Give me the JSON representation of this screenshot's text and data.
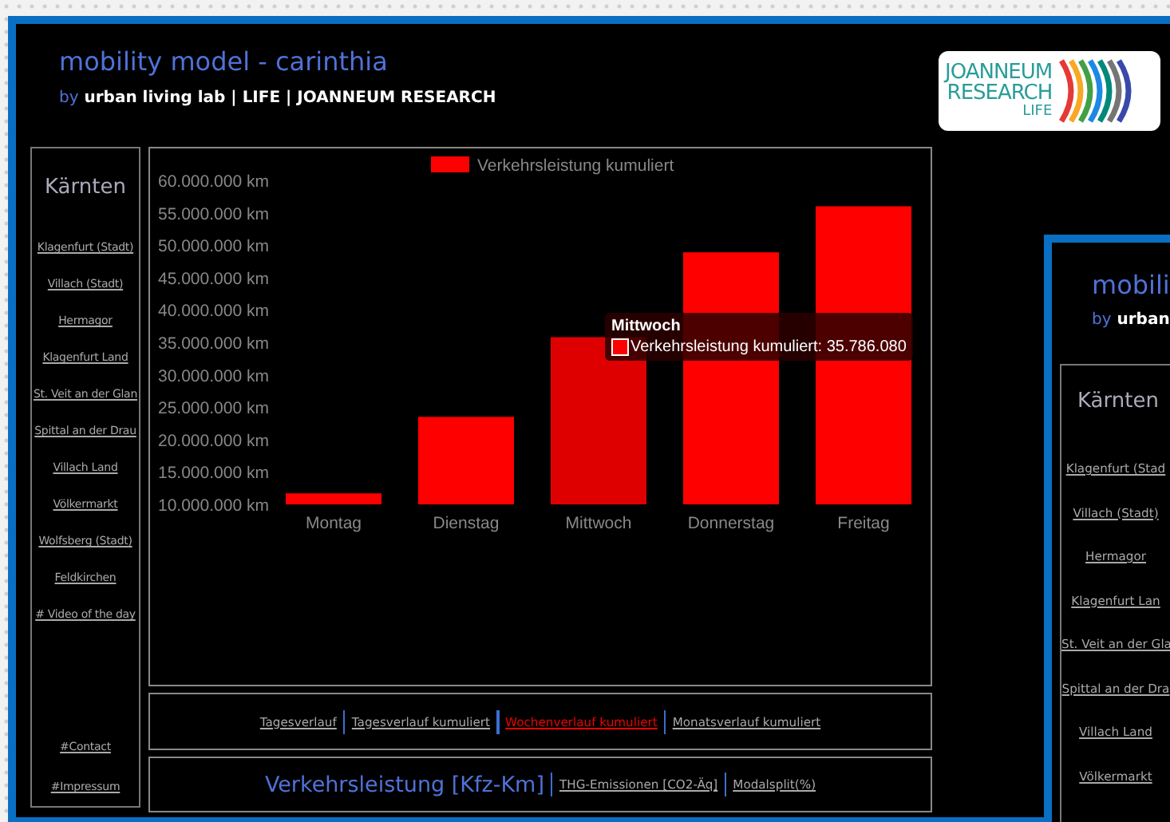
{
  "header": {
    "title": "mobility model - carinthia",
    "byline_prefix": "by",
    "byline": "urban living lab | LIFE | JOANNEUM RESEARCH"
  },
  "logo": {
    "lines": [
      "JOANNEUM",
      "RESEARCH"
    ],
    "sub": "LIFE"
  },
  "sidebar": {
    "title": "Kärnten",
    "items": [
      {
        "label": "Klagenfurt (Stadt)"
      },
      {
        "label": "Villach (Stadt)"
      },
      {
        "label": "Hermagor"
      },
      {
        "label": "Klagenfurt Land"
      },
      {
        "label": "St. Veit an der Glan"
      },
      {
        "label": "Spittal an der Drau"
      },
      {
        "label": "Villach Land"
      },
      {
        "label": "Völkermarkt"
      },
      {
        "label": "Wolfsberg (Stadt)"
      },
      {
        "label": "Feldkirchen"
      },
      {
        "label": "# Video of the day"
      }
    ],
    "footer_links": [
      {
        "label": "#Contact"
      },
      {
        "label": "#Impressum"
      }
    ]
  },
  "chart": {
    "chart_data": {
      "type": "bar",
      "categories": [
        "Montag",
        "Dienstag",
        "Mittwoch",
        "Donnerstag",
        "Freitag"
      ],
      "series": [
        {
          "name": "Verkehrsleistung kumuliert",
          "color": "#ff0000",
          "values": [
            11700000,
            23500000,
            35800000,
            48900000,
            56000000
          ]
        }
      ],
      "ylim": [
        10000000,
        60000000
      ],
      "yticks": [
        {
          "value": 10000000,
          "label": "10.000.000 km"
        },
        {
          "value": 15000000,
          "label": "15.000.000 km"
        },
        {
          "value": 20000000,
          "label": "20.000.000 km"
        },
        {
          "value": 25000000,
          "label": "25.000.000 km"
        },
        {
          "value": 30000000,
          "label": "30.000.000 km"
        },
        {
          "value": 35000000,
          "label": "35.000.000 km"
        },
        {
          "value": 40000000,
          "label": "40.000.000 km"
        },
        {
          "value": 45000000,
          "label": "45.000.000 km"
        },
        {
          "value": 50000000,
          "label": "50.000.000 km"
        },
        {
          "value": 55000000,
          "label": "55.000.000 km"
        },
        {
          "value": 60000000,
          "label": "60.000.000 km"
        }
      ]
    },
    "hovered_bars": [
      false,
      false,
      true,
      false,
      false
    ],
    "tooltip": {
      "title": "Mittwoch",
      "text": "Verkehrsleistung kumuliert: 35.786.080"
    }
  },
  "time_tabs": [
    {
      "label": "Tagesverlauf",
      "selected": false
    },
    {
      "label": "Tagesverlauf kumuliert",
      "selected": false
    },
    {
      "label": "Wochenverlauf kumuliert",
      "selected": true
    },
    {
      "label": "Monatsverlauf kumuliert",
      "selected": false
    }
  ],
  "metric_tabs": [
    {
      "label": "Verkehrsleistung [Kfz-Km]",
      "selected": true
    },
    {
      "label": "THG-Emissionen [CO2-Äq]",
      "selected": false
    },
    {
      "label": "Modalsplit(%)",
      "selected": false
    }
  ],
  "nested_window": {
    "title": "mobili",
    "byline_prefix": "by",
    "byline": "urban",
    "sidebar_title": "Kärnten",
    "items": [
      {
        "label": "Klagenfurt (Stad"
      },
      {
        "label": "Villach (Stadt)"
      },
      {
        "label": "Hermagor"
      },
      {
        "label": "Klagenfurt Lan"
      },
      {
        "label": "St. Veit an der Gla"
      },
      {
        "label": "Spittal an der Dra"
      },
      {
        "label": "Villach Land"
      },
      {
        "label": "Völkermarkt"
      }
    ]
  }
}
